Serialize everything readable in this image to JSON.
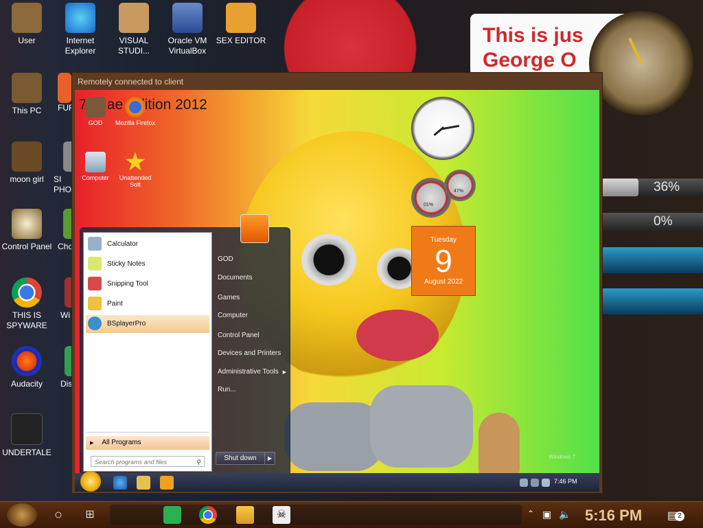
{
  "desktop_icons": [
    {
      "label": "User",
      "icon": "user-folder-icon"
    },
    {
      "label": "Internet Explorer",
      "icon": "edge-icon"
    },
    {
      "label": "VISUAL STUDI...",
      "icon": "visual-studio-icon"
    },
    {
      "label": "Oracle VM VirtualBox",
      "icon": "virtualbox-icon"
    },
    {
      "label": "SEX EDITOR",
      "icon": "hex-editor-icon"
    },
    {
      "label": "This PC",
      "icon": "this-pc-icon"
    },
    {
      "label": "FUR",
      "icon": "fur-icon"
    },
    {
      "label": "moon girl",
      "icon": "moon-girl-icon"
    },
    {
      "label": "SI PHO",
      "icon": "si-pho-icon"
    },
    {
      "label": "Control Panel",
      "icon": "control-panel-icon"
    },
    {
      "label": "Cho",
      "icon": "cho-icon"
    },
    {
      "label": "THIS IS SPYWARE",
      "icon": "chrome-icon"
    },
    {
      "label": "Wi",
      "icon": "wi-icon"
    },
    {
      "label": "Audacity",
      "icon": "audacity-icon"
    },
    {
      "label": "Dis",
      "icon": "dis-icon"
    },
    {
      "label": "UNDERTALE",
      "icon": "unity-icon"
    }
  ],
  "sticky_note": {
    "line1": "This is jus",
    "line2": "George O"
  },
  "gauges": {
    "g1": {
      "text": "36%",
      "value": 0.36
    },
    "g2": {
      "text": "0%",
      "value": 0
    }
  },
  "remote_window": {
    "title": "Remotely connected to client",
    "inner_title": "7 ... ae Edition 2012",
    "guest_icons": [
      "GOD",
      "Mozilla Firefox",
      "Computer",
      "Unattended Soft"
    ],
    "meter1": "01%",
    "meter2": "47%",
    "calendar": {
      "day": "Tuesday",
      "date": "9",
      "month": "August 2022"
    },
    "start_menu": {
      "programs": [
        "Calculator",
        "Sticky Notes",
        "Snipping Tool",
        "Paint",
        "BSplayerPro"
      ],
      "all_programs": "All Programs",
      "search_placeholder": "Search programs and files",
      "right": [
        "GOD",
        "Documents",
        "Games",
        "Computer",
        "Control Panel",
        "Devices and Printers",
        "Administrative Tools",
        "Run..."
      ],
      "shutdown": "Shut down"
    },
    "guest_time": "7:46 PM",
    "watermark": "Windows 7"
  },
  "taskbar": {
    "time": "5:16 PM",
    "notifications": "2"
  }
}
